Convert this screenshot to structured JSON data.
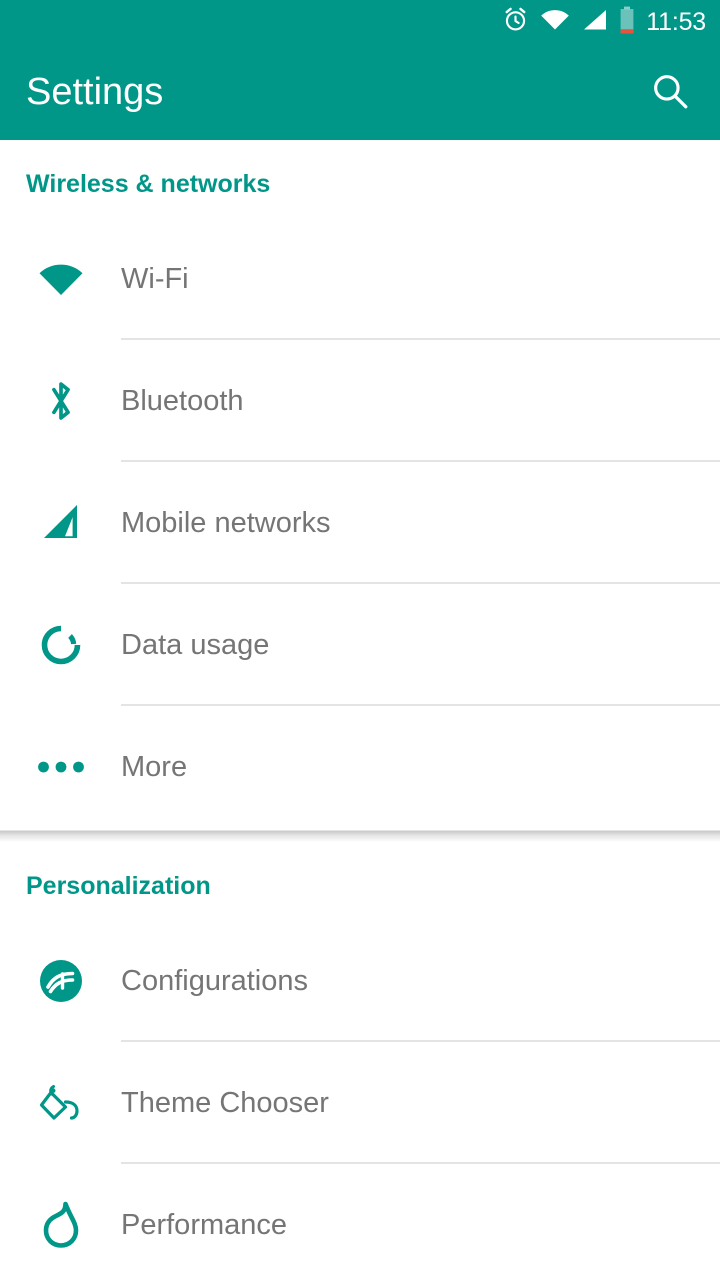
{
  "statusbar": {
    "time": "11:53",
    "icons": [
      {
        "name": "alarm-icon",
        "label": "Alarm set"
      },
      {
        "name": "wifi-signal-icon",
        "label": "Wi-Fi connected"
      },
      {
        "name": "cellular-signal-icon",
        "label": "Cellular signal"
      },
      {
        "name": "battery-icon",
        "label": "Battery low"
      }
    ],
    "background_color": "#009688",
    "foreground_color": "#ffffff",
    "battery_warning_color": "#e8543b"
  },
  "toolbar": {
    "title": "Settings",
    "search_label": "Search",
    "search_icon": "search-icon",
    "background_color": "#009688"
  },
  "theme": {
    "accent": "#009688",
    "label_text": "#757575",
    "divider": "#e4e4e4",
    "page_background": "#ffffff"
  },
  "sections": [
    {
      "title": "Wireless & networks",
      "items": [
        {
          "label": "Wi-Fi",
          "icon": "wifi-icon"
        },
        {
          "label": "Bluetooth",
          "icon": "bluetooth-icon"
        },
        {
          "label": "Mobile networks",
          "icon": "signal-bars-icon"
        },
        {
          "label": "Data usage",
          "icon": "data-usage-ring-icon"
        },
        {
          "label": "More",
          "icon": "more-dots-icon"
        }
      ]
    },
    {
      "title": "Personalization",
      "items": [
        {
          "label": "Configurations",
          "icon": "configurations-icon"
        },
        {
          "label": "Theme Chooser",
          "icon": "paint-bucket-icon"
        },
        {
          "label": "Performance",
          "icon": "flame-icon"
        }
      ]
    }
  ]
}
